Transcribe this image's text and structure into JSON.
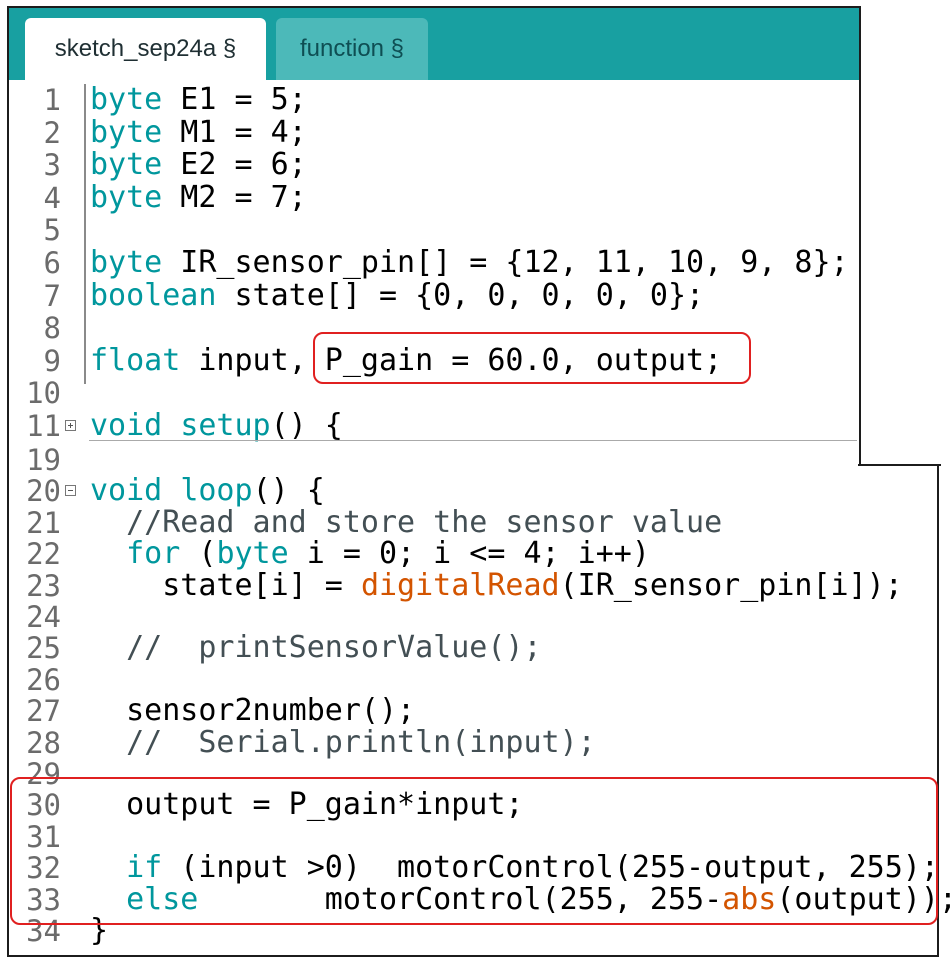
{
  "tabs": [
    {
      "label": "sketch_sep24a §",
      "active": true
    },
    {
      "label": "function §",
      "active": false
    }
  ],
  "colors": {
    "tab_bar": "#18a0a1",
    "keyword": "#00979d",
    "function": "#d35400",
    "highlight": "#e02020"
  },
  "editor_top": {
    "lines": [
      {
        "num": "1",
        "code": [
          {
            "t": "byte",
            "c": "kw"
          },
          {
            "t": " E1 = 5;",
            "c": ""
          }
        ]
      },
      {
        "num": "2",
        "code": [
          {
            "t": "byte",
            "c": "kw"
          },
          {
            "t": " M1 = 4;",
            "c": ""
          }
        ]
      },
      {
        "num": "3",
        "code": [
          {
            "t": "byte",
            "c": "kw"
          },
          {
            "t": " E2 = 6;",
            "c": ""
          }
        ]
      },
      {
        "num": "4",
        "code": [
          {
            "t": "byte",
            "c": "kw"
          },
          {
            "t": " M2 = 7;",
            "c": ""
          }
        ]
      },
      {
        "num": "5",
        "code": []
      },
      {
        "num": "6",
        "code": [
          {
            "t": "byte",
            "c": "kw"
          },
          {
            "t": " IR_sensor_pin[] = {12, 11, 10, 9, 8};",
            "c": ""
          }
        ]
      },
      {
        "num": "7",
        "code": [
          {
            "t": "boolean",
            "c": "kw"
          },
          {
            "t": " state[] = {0, 0, 0, 0, 0};",
            "c": ""
          }
        ]
      },
      {
        "num": "8",
        "code": []
      },
      {
        "num": "9",
        "code": [
          {
            "t": "float",
            "c": "kw"
          },
          {
            "t": " input, P_gain = 60.0, output;",
            "c": ""
          }
        ]
      },
      {
        "num": "10",
        "code": []
      },
      {
        "num": "11",
        "fold": "plus",
        "code": [
          {
            "t": "void",
            "c": "kw"
          },
          {
            "t": " ",
            "c": ""
          },
          {
            "t": "setup",
            "c": "kw"
          },
          {
            "t": "() {",
            "c": ""
          }
        ]
      }
    ]
  },
  "editor_bottom": {
    "lines": [
      {
        "num": "19",
        "code": []
      },
      {
        "num": "20",
        "fold": "minus",
        "code": [
          {
            "t": "void",
            "c": "kw"
          },
          {
            "t": " ",
            "c": ""
          },
          {
            "t": "loop",
            "c": "kw"
          },
          {
            "t": "() {",
            "c": ""
          }
        ]
      },
      {
        "num": "21",
        "code": [
          {
            "t": "  //Read and store the sensor value",
            "c": "cm"
          }
        ]
      },
      {
        "num": "22",
        "code": [
          {
            "t": "  ",
            "c": ""
          },
          {
            "t": "for",
            "c": "kw"
          },
          {
            "t": " (",
            "c": ""
          },
          {
            "t": "byte",
            "c": "kw"
          },
          {
            "t": " i = 0; i <= 4; i++)",
            "c": ""
          }
        ]
      },
      {
        "num": "23",
        "code": [
          {
            "t": "    state[i] = ",
            "c": ""
          },
          {
            "t": "digitalRead",
            "c": "fn"
          },
          {
            "t": "(IR_sensor_pin[i]);",
            "c": ""
          }
        ]
      },
      {
        "num": "24",
        "code": []
      },
      {
        "num": "25",
        "code": [
          {
            "t": "  //  printSensorValue();",
            "c": "cm"
          }
        ]
      },
      {
        "num": "26",
        "code": []
      },
      {
        "num": "27",
        "code": [
          {
            "t": "  sensor2number();",
            "c": ""
          }
        ]
      },
      {
        "num": "28",
        "code": [
          {
            "t": "  //  Serial.println(input);",
            "c": "cm"
          }
        ]
      },
      {
        "num": "29",
        "code": []
      },
      {
        "num": "30",
        "code": [
          {
            "t": "  output = P_gain*input;",
            "c": ""
          }
        ]
      },
      {
        "num": "31",
        "code": []
      },
      {
        "num": "32",
        "code": [
          {
            "t": "  ",
            "c": ""
          },
          {
            "t": "if",
            "c": "kw"
          },
          {
            "t": " (input >0)  motorControl(255-output, 255);",
            "c": ""
          }
        ]
      },
      {
        "num": "33",
        "code": [
          {
            "t": "  ",
            "c": ""
          },
          {
            "t": "else",
            "c": "kw"
          },
          {
            "t": "       motorControl(255, 255-",
            "c": ""
          },
          {
            "t": "abs",
            "c": "fn"
          },
          {
            "t": "(output));",
            "c": ""
          }
        ]
      },
      {
        "num": "34",
        "code": [
          {
            "t": "}",
            "c": ""
          }
        ]
      }
    ]
  }
}
